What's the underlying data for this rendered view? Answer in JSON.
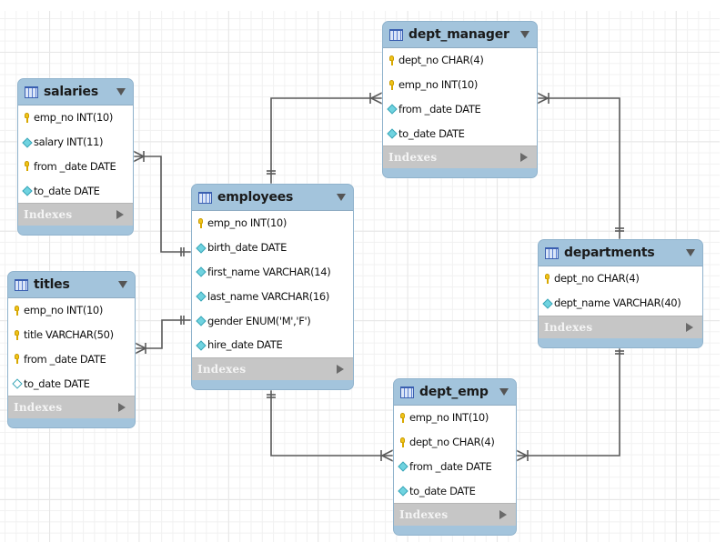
{
  "diagram": {
    "type": "EER diagram",
    "tables": [
      {
        "id": "salaries",
        "name": "salaries",
        "columns": [
          {
            "icon": "primary-key-icon",
            "text": "emp_no INT(10)"
          },
          {
            "icon": "column-icon",
            "text": "salary INT(11)"
          },
          {
            "icon": "primary-key-icon",
            "text": "from _date DATE"
          },
          {
            "icon": "column-icon",
            "text": "to_date DATE"
          }
        ],
        "indexes_label": "Indexes"
      },
      {
        "id": "titles",
        "name": "titles",
        "columns": [
          {
            "icon": "primary-key-icon",
            "text": "emp_no INT(10)"
          },
          {
            "icon": "primary-key-icon",
            "text": "title VARCHAR(50)"
          },
          {
            "icon": "primary-key-icon",
            "text": "from _date DATE"
          },
          {
            "icon": "nullable-column-icon",
            "text": "to_date DATE"
          }
        ],
        "indexes_label": "Indexes"
      },
      {
        "id": "employees",
        "name": "employees",
        "columns": [
          {
            "icon": "primary-key-icon",
            "text": "emp_no INT(10)"
          },
          {
            "icon": "column-icon",
            "text": "birth_date DATE"
          },
          {
            "icon": "column-icon",
            "text": "first_name VARCHAR(14)"
          },
          {
            "icon": "column-icon",
            "text": "last_name VARCHAR(16)"
          },
          {
            "icon": "column-icon",
            "text": "gender ENUM('M','F')"
          },
          {
            "icon": "column-icon",
            "text": "hire_date DATE"
          }
        ],
        "indexes_label": "Indexes"
      },
      {
        "id": "dept_manager",
        "name": "dept_manager",
        "columns": [
          {
            "icon": "primary-key-icon",
            "text": "dept_no CHAR(4)"
          },
          {
            "icon": "primary-key-icon",
            "text": "emp_no INT(10)"
          },
          {
            "icon": "column-icon",
            "text": "from _date DATE"
          },
          {
            "icon": "column-icon",
            "text": "to_date DATE"
          }
        ],
        "indexes_label": "Indexes"
      },
      {
        "id": "departments",
        "name": "departments",
        "columns": [
          {
            "icon": "primary-key-icon",
            "text": "dept_no CHAR(4)"
          },
          {
            "icon": "column-icon",
            "text": "dept_name VARCHAR(40)"
          }
        ],
        "indexes_label": "Indexes"
      },
      {
        "id": "dept_emp",
        "name": "dept_emp",
        "columns": [
          {
            "icon": "primary-key-icon",
            "text": "emp_no INT(10)"
          },
          {
            "icon": "primary-key-icon",
            "text": "dept_no CHAR(4)"
          },
          {
            "icon": "column-icon",
            "text": "from _date DATE"
          },
          {
            "icon": "column-icon",
            "text": "to_date DATE"
          }
        ],
        "indexes_label": "Indexes"
      }
    ],
    "relationships": [
      {
        "from": "employees",
        "to": "salaries",
        "from_cardinality": "one",
        "to_cardinality": "many"
      },
      {
        "from": "employees",
        "to": "titles",
        "from_cardinality": "one",
        "to_cardinality": "many"
      },
      {
        "from": "employees",
        "to": "dept_manager",
        "from_cardinality": "one",
        "to_cardinality": "many"
      },
      {
        "from": "departments",
        "to": "dept_manager",
        "from_cardinality": "one",
        "to_cardinality": "many"
      },
      {
        "from": "employees",
        "to": "dept_emp",
        "from_cardinality": "one",
        "to_cardinality": "many"
      },
      {
        "from": "departments",
        "to": "dept_emp",
        "from_cardinality": "one",
        "to_cardinality": "many"
      }
    ],
    "colors": {
      "header": "#a3c4dc",
      "indexes_bar": "#c6c6c6",
      "primary_key": "#f0c419",
      "column": "#6fd3e0",
      "connector": "#5a5a5a"
    }
  }
}
